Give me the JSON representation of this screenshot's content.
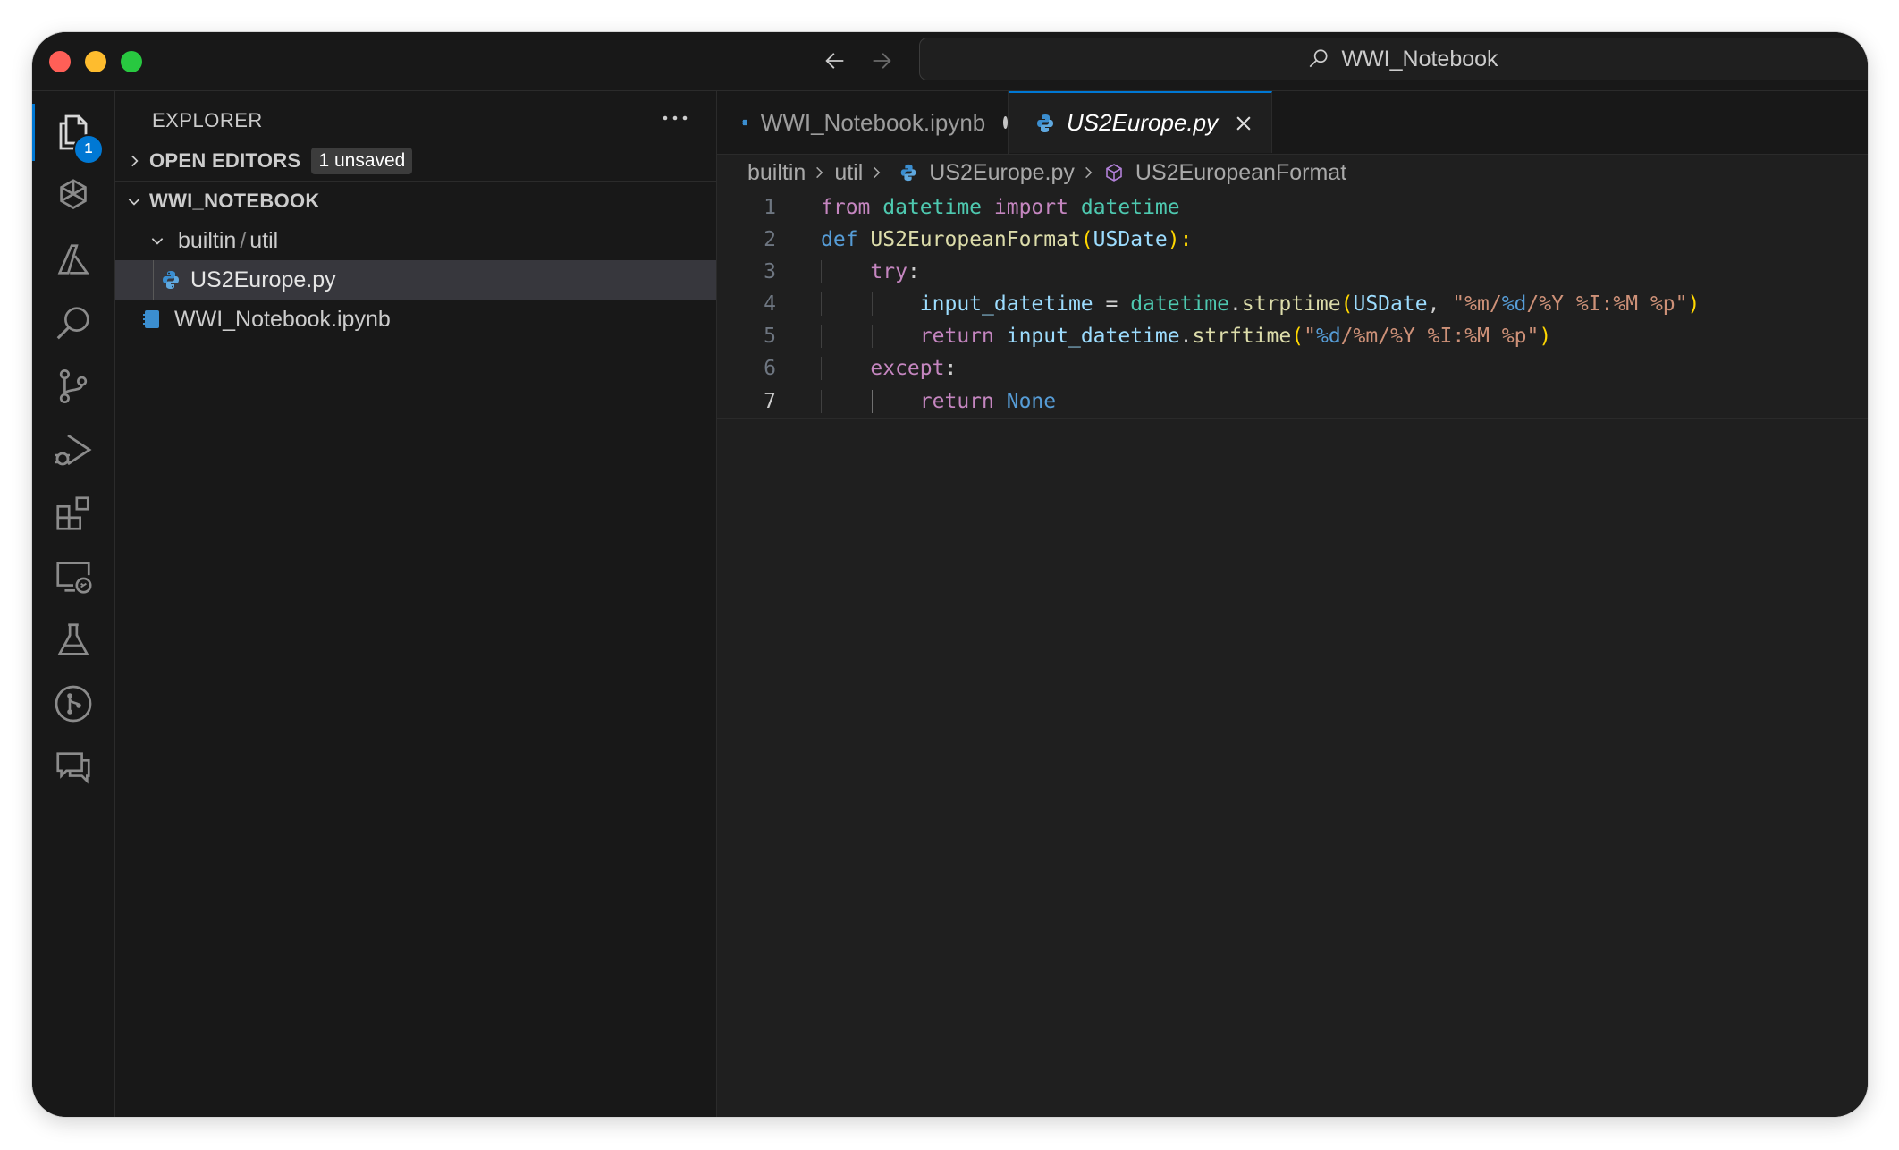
{
  "window": {
    "search_title": "WWI_Notebook"
  },
  "activity_bar": {
    "explorer_badge": "1"
  },
  "sidebar": {
    "header": "EXPLORER",
    "open_editors": {
      "label": "OPEN EDITORS",
      "badge": "1 unsaved"
    },
    "workspace": {
      "label": "WWI_NOTEBOOK"
    },
    "folder": {
      "part1": "builtin",
      "sep": "/",
      "part2": "util"
    },
    "files": [
      {
        "name": "US2Europe.py"
      },
      {
        "name": "WWI_Notebook.ipynb"
      }
    ]
  },
  "tabs": [
    {
      "label": "WWI_Notebook.ipynb"
    },
    {
      "label": "US2Europe.py"
    }
  ],
  "breadcrumbs": [
    "builtin",
    "util",
    "US2Europe.py",
    "US2EuropeanFormat"
  ],
  "code": {
    "line_numbers": [
      "1",
      "2",
      "3",
      "4",
      "5",
      "6",
      "7"
    ],
    "l1": {
      "a": "from",
      "b": "datetime",
      "c": "import",
      "d": "datetime"
    },
    "l2": {
      "a": "def",
      "b": "US2EuropeanFormat",
      "c": "(",
      "d": "USDate",
      "e": "):"
    },
    "l3": {
      "a": "try",
      "b": ":"
    },
    "l4": {
      "a": "input_datetime",
      "b": " = ",
      "c": "datetime",
      "d": ".",
      "e": "strptime",
      "f": "(",
      "g": "USDate",
      "h": ", ",
      "i1": "\"",
      "i2": "%m",
      "i3": "/",
      "i4": "%d",
      "i5": "/",
      "i6": "%Y",
      "i7": " ",
      "i8": "%I",
      "i9": ":",
      "i10": "%M",
      "i11": " ",
      "i12": "%p",
      "i13": "\"",
      "j": ")"
    },
    "l5": {
      "a": "return",
      "b": "input_datetime",
      "c": ".",
      "d": "strftime",
      "e": "(",
      "f1": "\"",
      "f2": "%d",
      "f3": "/",
      "f4": "%m",
      "f5": "/",
      "f6": "%Y",
      "f7": " ",
      "f8": "%I",
      "f9": ":",
      "f10": "%M",
      "f11": " ",
      "f12": "%p",
      "f13": "\"",
      "g": ")"
    },
    "l6": {
      "a": "except",
      "b": ":"
    },
    "l7": {
      "a": "return",
      "b": "None"
    }
  },
  "colors": {
    "accent": "#0078d4",
    "background": "#1f1f1f",
    "sidebar": "#181818"
  }
}
